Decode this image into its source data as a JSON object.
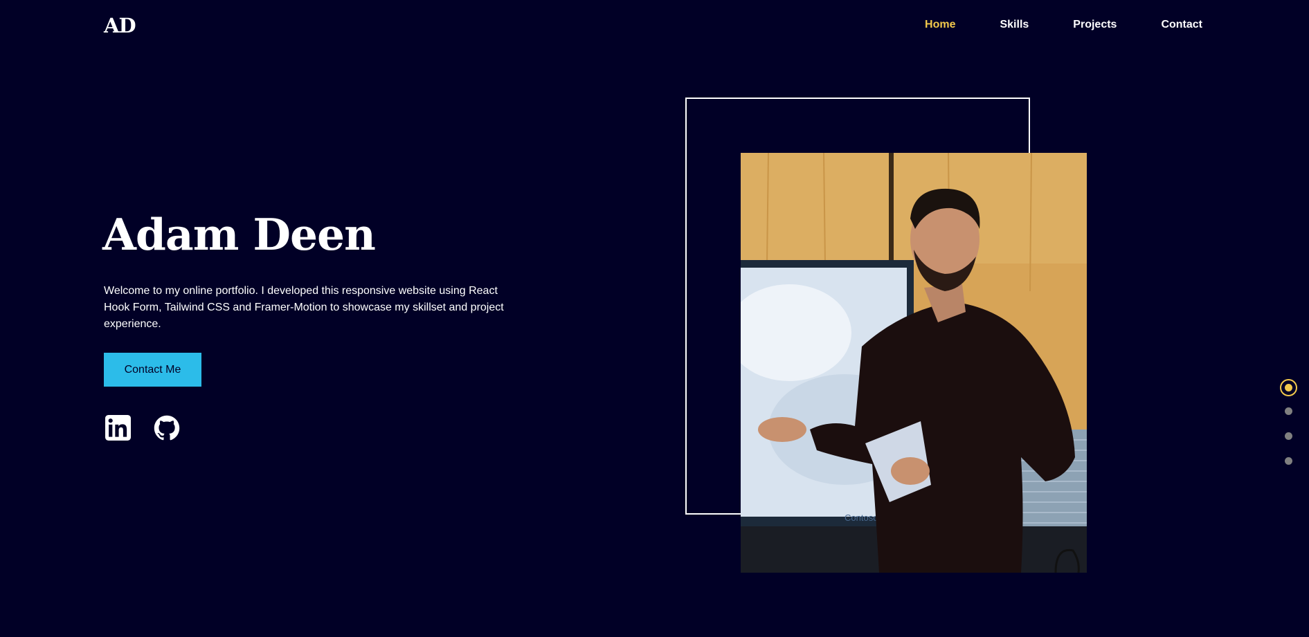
{
  "nav": {
    "logo": "AD",
    "items": [
      {
        "label": "Home",
        "active": true
      },
      {
        "label": "Skills",
        "active": false
      },
      {
        "label": "Projects",
        "active": false
      },
      {
        "label": "Contact",
        "active": false
      }
    ]
  },
  "hero": {
    "name": "Adam Deen",
    "description": "Welcome to my online portfolio. I developed this responsive website using React Hook Form, Tailwind CSS and Framer-Motion to showcase my skillset and project experience.",
    "button_label": "Contact Me"
  },
  "social": {
    "linkedin_icon": "linkedin-icon",
    "github_icon": "github-icon"
  },
  "photo": {
    "alt": "Adam Deen presenting",
    "screen_logo": "Contoso"
  },
  "dot_nav": {
    "count": 4,
    "active_index": 0,
    "active_color": "#f2c94c",
    "inactive_color": "#808080"
  },
  "colors": {
    "background": "#010026",
    "accent_yellow": "#f2c94c",
    "button_blue": "#2cbce9",
    "text": "#ffffff"
  }
}
